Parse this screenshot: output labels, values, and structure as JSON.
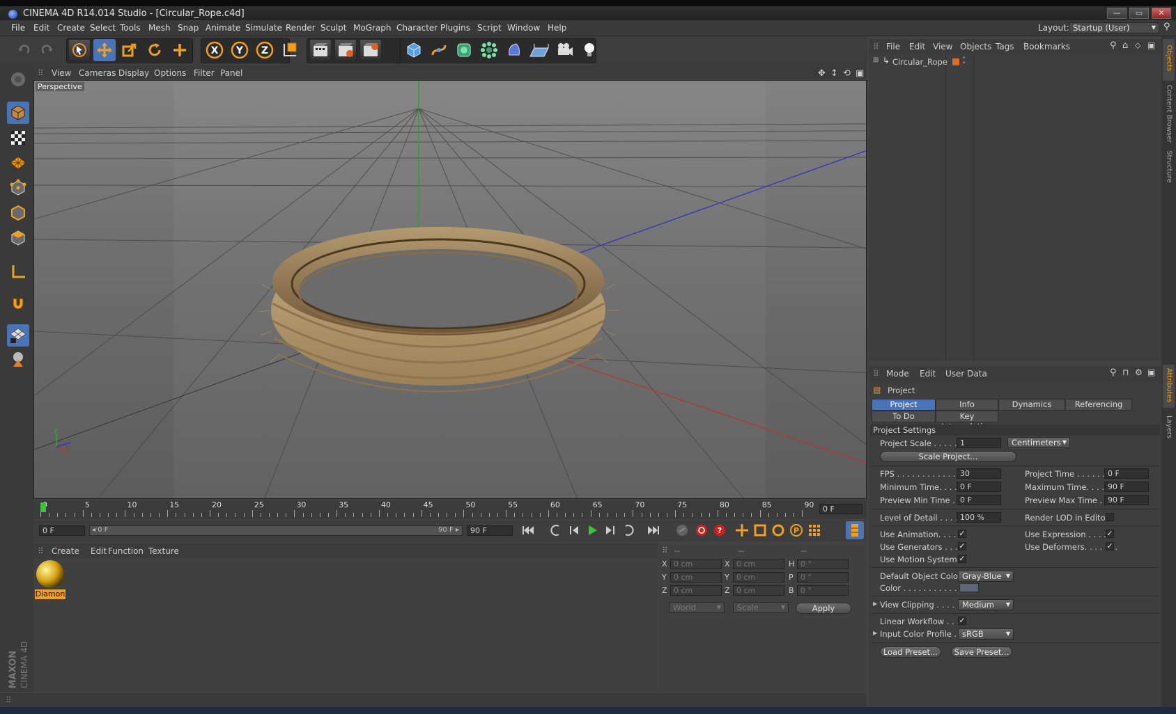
{
  "window": {
    "title": "CINEMA 4D R14.014 Studio - [Circular_Rope.c4d]",
    "minimize": "—",
    "maximize": "▭",
    "close": "✕"
  },
  "menubar": {
    "items": [
      "File",
      "Edit",
      "Create",
      "Select",
      "Tools",
      "Mesh",
      "Snap",
      "Animate",
      "Simulate",
      "Render",
      "Sculpt",
      "MoGraph",
      "Character",
      "Plugins",
      "Script",
      "Window",
      "Help"
    ],
    "layout_label": "Layout:",
    "layout_value": "Startup (User)"
  },
  "viewport": {
    "menu": [
      "View",
      "Cameras",
      "Display",
      "Options",
      "Filter",
      "Panel"
    ],
    "label": "Perspective",
    "axis_x": "x",
    "axis_y": "y"
  },
  "timeline": {
    "ticks": [
      "0",
      "5",
      "10",
      "15",
      "20",
      "25",
      "30",
      "35",
      "40",
      "45",
      "50",
      "55",
      "60",
      "65",
      "70",
      "75",
      "80",
      "85",
      "90"
    ],
    "frame_display": "0 F"
  },
  "transport": {
    "start": "0 F",
    "range_start": "◂ 0 F",
    "range_end": "90 F ▸",
    "end": "90 F"
  },
  "materials": {
    "menu": [
      "Create",
      "Edit",
      "Function",
      "Texture"
    ],
    "items": [
      {
        "name": "Diamon"
      }
    ]
  },
  "coordinates": {
    "headers": [
      "--",
      "--",
      "--"
    ],
    "rows": [
      {
        "a": "X",
        "av": "0 cm",
        "b": "X",
        "bv": "0 cm",
        "c": "H",
        "cv": "0 °"
      },
      {
        "a": "Y",
        "av": "0 cm",
        "b": "Y",
        "bv": "0 cm",
        "c": "P",
        "cv": "0 °"
      },
      {
        "a": "Z",
        "av": "0 cm",
        "b": "Z",
        "bv": "0 cm",
        "c": "B",
        "cv": "0 °"
      }
    ],
    "world": "World",
    "scale": "Scale",
    "apply": "Apply"
  },
  "objects": {
    "menu": [
      "File",
      "Edit",
      "View",
      "Objects",
      "Tags",
      "Bookmarks"
    ],
    "items": [
      {
        "name": "Circular_Rope"
      }
    ]
  },
  "attributes": {
    "menu": [
      "Mode",
      "Edit",
      "User Data"
    ],
    "header": "Project",
    "tabs": [
      "Project Settings",
      "Info",
      "Dynamics",
      "Referencing"
    ],
    "tabs2": [
      "To Do",
      "Key Interpolation"
    ],
    "section": "Project Settings",
    "project_scale_label": "Project Scale . . . . . .",
    "project_scale_value": "1",
    "units": "Centimeters",
    "scale_project": "Scale Project...",
    "fps_label": "FPS . . . . . . . . . . . . . . .",
    "fps": "30",
    "project_time_label": "Project Time . . . . . . . .",
    "project_time": "0 F",
    "min_time_label": "Minimum Time. . . . .",
    "min_time": "0 F",
    "max_time_label": "Maximum Time. . . . .",
    "max_time": "90 F",
    "prev_min_label": "Preview Min Time . .",
    "prev_min": "0 F",
    "prev_max_label": "Preview Max Time . . .",
    "prev_max": "90 F",
    "lod_label": "Level of Detail . . . . . .",
    "lod": "100 %",
    "render_lod_label": "Render LOD in Editor",
    "use_anim": "Use Animation. . . . .",
    "use_expr": "Use Expression . . . . .",
    "use_gen": "Use Generators . . . .",
    "use_def": "Use Deformers. . . . . . .",
    "use_motion": "Use Motion System",
    "def_color_label": "Default Object Color",
    "def_color": "Gray-Blue",
    "color_label": "Color . . . . . . . . . . .",
    "view_clip_label": "View Clipping . . . . .",
    "view_clip": "Medium",
    "linear_label": "Linear Workflow . . .",
    "input_profile_label": "Input Color Profile .",
    "input_profile": "sRGB",
    "load_preset": "Load Preset...",
    "save_preset": "Save Preset...",
    "check": "✓"
  },
  "side_tabs": [
    "Objects",
    "Content Browser",
    "Structure",
    "Attributes",
    "Layers"
  ],
  "brand": {
    "line1": "MAXON",
    "line2": "CINEMA 4D"
  }
}
